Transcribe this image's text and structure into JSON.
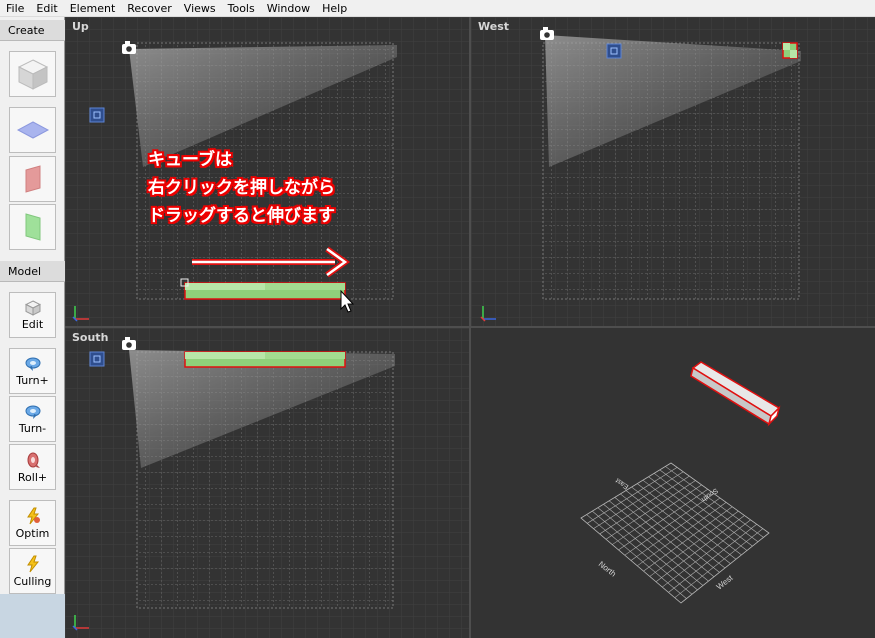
{
  "menu": [
    "File",
    "Edit",
    "Element",
    "Recover",
    "Views",
    "Tools",
    "Window",
    "Help"
  ],
  "toolbar": {
    "create_label": "Create",
    "model_label": "Model",
    "buttons": {
      "edit": "Edit",
      "turn_plus": "Turn+",
      "turn_minus": "Turn-",
      "roll_plus": "Roll+",
      "optim": "Optim",
      "culling": "Culling"
    }
  },
  "viewports": {
    "up": "Up",
    "west": "West",
    "south": "South"
  },
  "annotation": {
    "line1": "キューブは",
    "line2": "右クリックを押しながら",
    "line3": "ドラッグすると伸びます"
  },
  "perspective_labels": {
    "north": "North",
    "west": "West",
    "south": "South",
    "east": "East"
  },
  "colors": {
    "accent_red": "#e01010",
    "cube_green": "#8fd07a",
    "marker_blue": "#3a66b8"
  }
}
